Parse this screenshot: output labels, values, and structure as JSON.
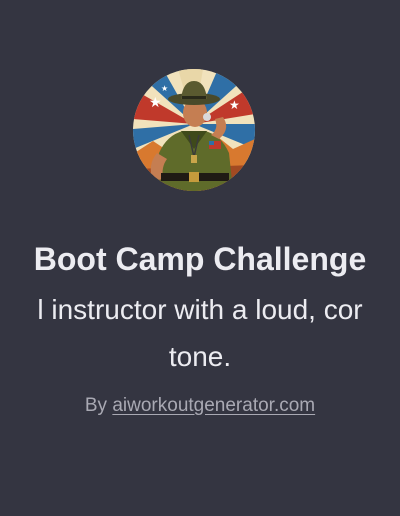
{
  "gpt": {
    "avatar_icon": "drill-sergeant-avatar-icon",
    "title": "Boot Camp Challenge",
    "description_line1": "l instructor with a loud, cor",
    "description_line2": "tone.",
    "byline_prefix": "By",
    "author": "aiworkoutgenerator.com"
  },
  "colors": {
    "background": "#343541",
    "text": "#ececf1",
    "muted": "#a9a9b3"
  }
}
